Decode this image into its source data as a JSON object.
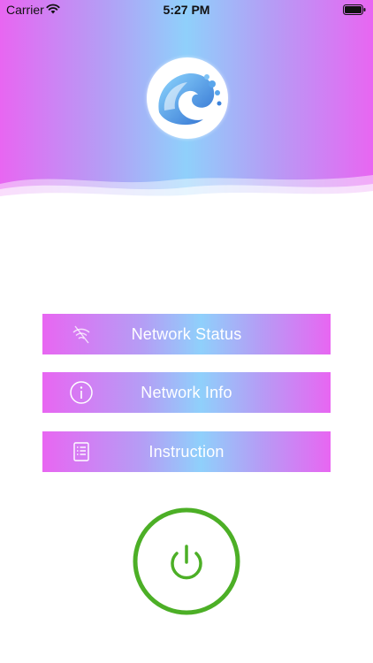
{
  "status_bar": {
    "carrier": "Carrier",
    "time": "5:27 PM",
    "signal_icon": "wifi-icon",
    "battery_icon": "battery-icon"
  },
  "header": {
    "logo_icon": "wave-logo-icon",
    "gradient_colors": [
      "#e866f2",
      "#8fd0fb"
    ]
  },
  "menu": {
    "items": [
      {
        "label": "Network Status",
        "icon": "wifi-off-icon"
      },
      {
        "label": "Network Info",
        "icon": "info-icon"
      },
      {
        "label": "Instruction",
        "icon": "list-icon"
      }
    ]
  },
  "power": {
    "icon": "power-icon",
    "color": "#4caf26"
  }
}
